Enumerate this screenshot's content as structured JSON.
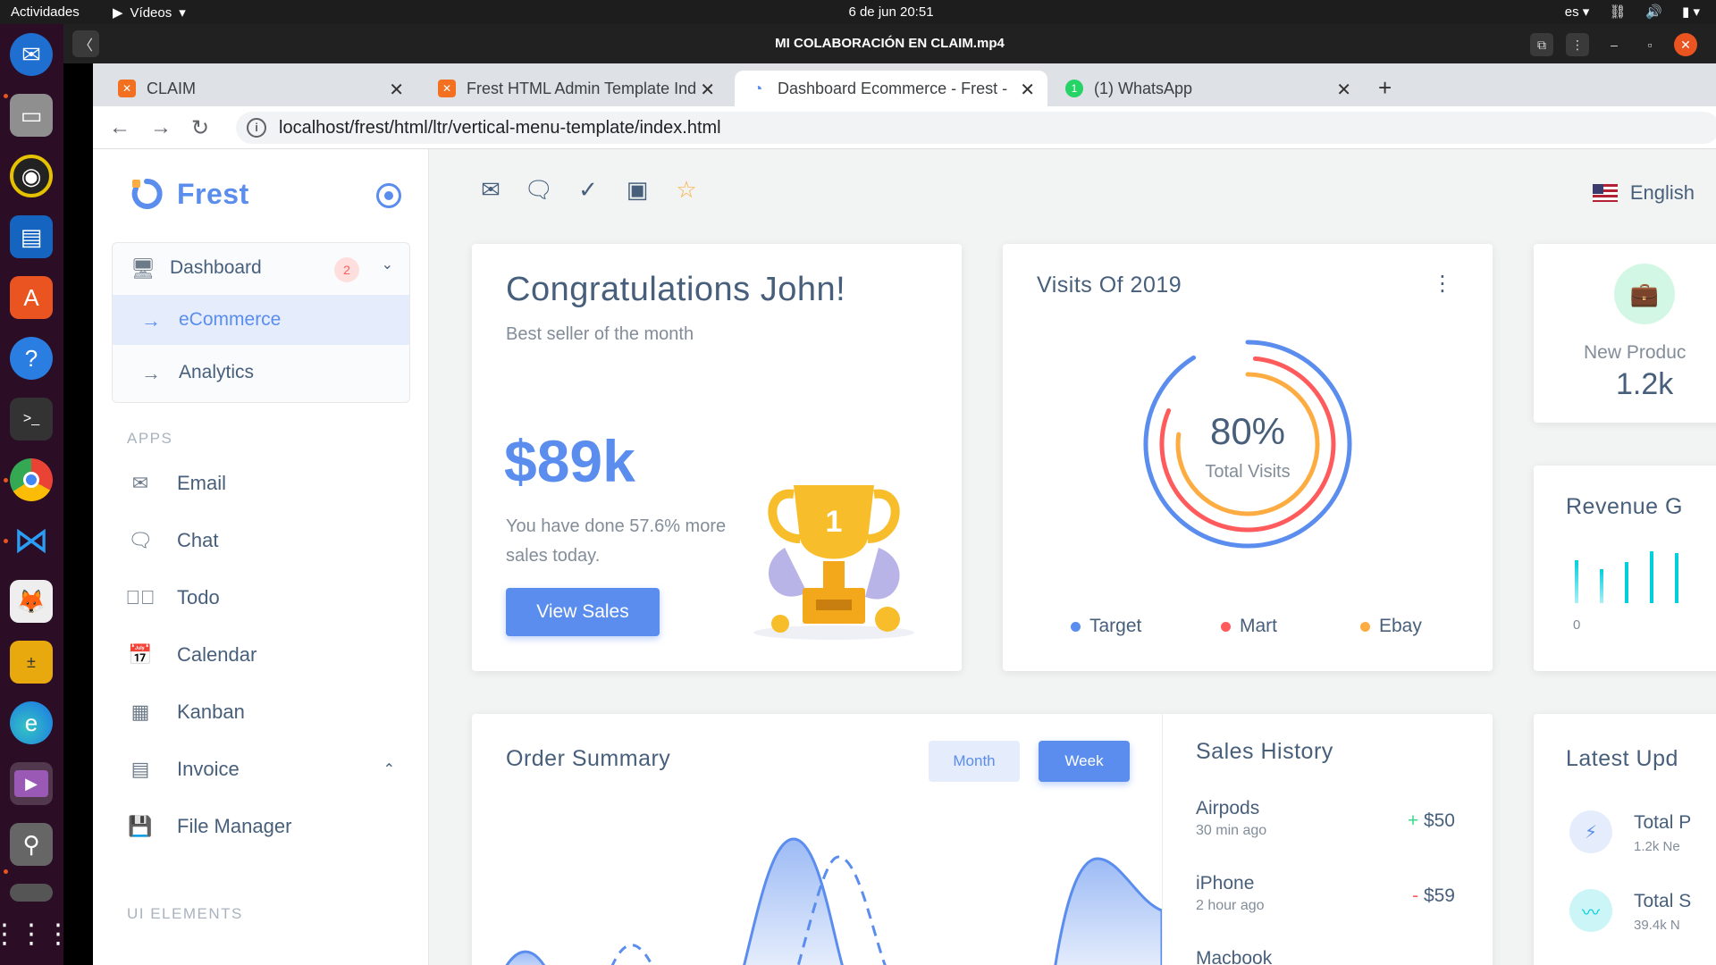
{
  "topbar": {
    "activities": "Actividades",
    "app_name": "Vídeos",
    "clock": "6 de jun  20:51",
    "lang": "es"
  },
  "player": {
    "title": "MI COLABORACIÓN EN CLAIM.mp4"
  },
  "dock": {
    "icons": [
      "thunderbird-icon",
      "files-icon",
      "rhythmbox-icon",
      "writer-icon",
      "software-icon",
      "help-icon",
      "terminal-icon",
      "chrome-icon",
      "vscode-icon",
      "gimp-icon",
      "calculator-icon",
      "edge-icon",
      "videos-icon",
      "usb-icon",
      "trash-icon",
      "app-grid-icon"
    ]
  },
  "browser": {
    "tabs": [
      {
        "label": "CLAIM"
      },
      {
        "label": "Frest HTML Admin Template Inde"
      },
      {
        "label": "Dashboard Ecommerce - Frest - I"
      },
      {
        "label": "(1) WhatsApp"
      }
    ],
    "url": "localhost/frest/html/ltr/vertical-menu-template/index.html"
  },
  "sidebar": {
    "brand": "Frest",
    "dashboard": {
      "label": "Dashboard",
      "badge": "2"
    },
    "sub_items": [
      {
        "label": "eCommerce"
      },
      {
        "label": "Analytics"
      }
    ],
    "apps_heading": "APPS",
    "apps": [
      {
        "label": "Email",
        "icon": "mail-icon"
      },
      {
        "label": "Chat",
        "icon": "chat-icon"
      },
      {
        "label": "Todo",
        "icon": "check-circle-icon"
      },
      {
        "label": "Calendar",
        "icon": "calendar-icon"
      },
      {
        "label": "Kanban",
        "icon": "kanban-icon"
      },
      {
        "label": "Invoice",
        "icon": "invoice-icon"
      },
      {
        "label": "File Manager",
        "icon": "save-icon"
      }
    ],
    "ui_heading": "UI ELEMENTS"
  },
  "header": {
    "language": "English"
  },
  "congrats": {
    "title": "Congratulations John!",
    "subtitle": "Best seller of the month",
    "amount": "$89k",
    "description": "You have done 57.6% more sales today.",
    "button": "View Sales"
  },
  "visits": {
    "title": "Visits Of 2019",
    "percent": "80%",
    "label": "Total Visits",
    "legend": [
      {
        "label": "Target",
        "color": "#5a8dee"
      },
      {
        "label": "Mart",
        "color": "#ff5b5c"
      },
      {
        "label": "Ebay",
        "color": "#fdac41"
      }
    ]
  },
  "new_products": {
    "label": "New Produc",
    "value": "1.2k"
  },
  "revenue": {
    "title": "Revenue G",
    "axis_zero": "0"
  },
  "order_summary": {
    "title": "Order Summary",
    "month": "Month",
    "week": "Week"
  },
  "sales_history": {
    "title": "Sales History",
    "items": [
      {
        "name": "Airpods",
        "time": "30 min ago",
        "sign": "+",
        "amount": "$50"
      },
      {
        "name": "iPhone",
        "time": "2 hour ago",
        "sign": "-",
        "amount": "$59"
      },
      {
        "name": "Macbook"
      }
    ]
  },
  "latest_updates": {
    "title": "Latest Upd",
    "items": [
      {
        "title": "Total P",
        "sub": "1.2k Ne"
      },
      {
        "title": "Total S",
        "sub": "39.4k N"
      }
    ]
  },
  "colors": {
    "primary": "#5a8dee",
    "danger": "#ff5b5c",
    "warning": "#fdac41",
    "success": "#39da8a",
    "info": "#00cfdd"
  }
}
